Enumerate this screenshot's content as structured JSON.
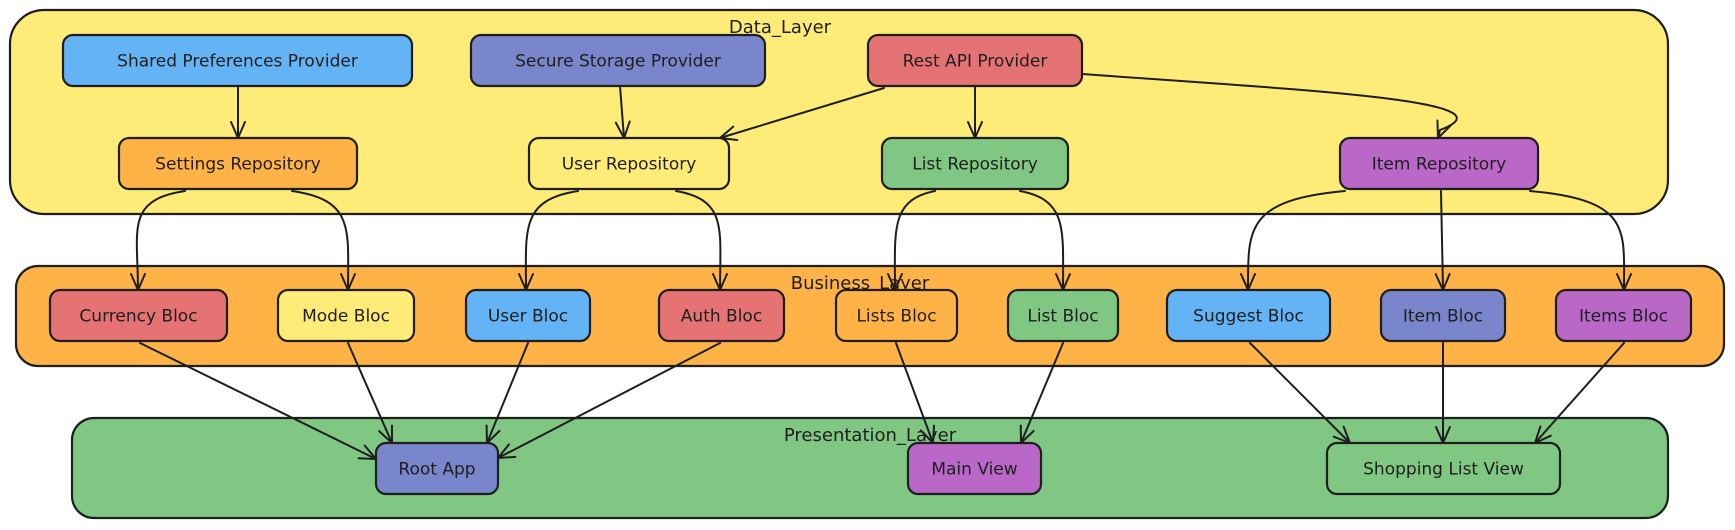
{
  "diagram": {
    "type": "layered-architecture",
    "layers": [
      {
        "id": "data",
        "label": "Data_Layer",
        "color": "#ffec78"
      },
      {
        "id": "business",
        "label": "Business_Layer",
        "color": "#ffb347"
      },
      {
        "id": "presentation",
        "label": "Presentation_Layer",
        "color": "#80c783"
      }
    ],
    "nodes": [
      {
        "id": "shared_prefs",
        "label": "Shared Preferences Provider",
        "layer": "data",
        "color": "#63b3f5"
      },
      {
        "id": "secure_storage",
        "label": "Secure Storage Provider",
        "layer": "data",
        "color": "#7986cb"
      },
      {
        "id": "rest_api",
        "label": "Rest API Provider",
        "layer": "data",
        "color": "#e57373"
      },
      {
        "id": "settings_repo",
        "label": "Settings Repository",
        "layer": "data",
        "color": "#ffb347"
      },
      {
        "id": "user_repo",
        "label": "User Repository",
        "layer": "data",
        "color": "#ffec78"
      },
      {
        "id": "list_repo",
        "label": "List Repository",
        "layer": "data",
        "color": "#80c783"
      },
      {
        "id": "item_repo",
        "label": "Item Repository",
        "layer": "data",
        "color": "#ba68c8"
      },
      {
        "id": "currency_bloc",
        "label": "Currency Bloc",
        "layer": "business",
        "color": "#e57373"
      },
      {
        "id": "mode_bloc",
        "label": "Mode Bloc",
        "layer": "business",
        "color": "#ffec78"
      },
      {
        "id": "user_bloc",
        "label": "User Bloc",
        "layer": "business",
        "color": "#63b3f5"
      },
      {
        "id": "auth_bloc",
        "label": "Auth Bloc",
        "layer": "business",
        "color": "#e57373"
      },
      {
        "id": "lists_bloc",
        "label": "Lists Bloc",
        "layer": "business",
        "color": "#ffb347"
      },
      {
        "id": "list_bloc",
        "label": "List Bloc",
        "layer": "business",
        "color": "#80c783"
      },
      {
        "id": "suggest_bloc",
        "label": "Suggest Bloc",
        "layer": "business",
        "color": "#63b3f5"
      },
      {
        "id": "item_bloc",
        "label": "Item Bloc",
        "layer": "business",
        "color": "#7986cb"
      },
      {
        "id": "items_bloc",
        "label": "Items Bloc",
        "layer": "business",
        "color": "#ba68c8"
      },
      {
        "id": "root_app",
        "label": "Root App",
        "layer": "presentation",
        "color": "#7986cb"
      },
      {
        "id": "main_view",
        "label": "Main View",
        "layer": "presentation",
        "color": "#ba68c8"
      },
      {
        "id": "shopping_list_view",
        "label": "Shopping List View",
        "layer": "presentation",
        "color": "#80c783"
      }
    ],
    "edges": [
      {
        "from": "shared_prefs",
        "to": "settings_repo"
      },
      {
        "from": "secure_storage",
        "to": "user_repo"
      },
      {
        "from": "rest_api",
        "to": "user_repo"
      },
      {
        "from": "rest_api",
        "to": "list_repo"
      },
      {
        "from": "rest_api",
        "to": "item_repo"
      },
      {
        "from": "settings_repo",
        "to": "currency_bloc"
      },
      {
        "from": "settings_repo",
        "to": "mode_bloc"
      },
      {
        "from": "user_repo",
        "to": "user_bloc"
      },
      {
        "from": "user_repo",
        "to": "auth_bloc"
      },
      {
        "from": "list_repo",
        "to": "lists_bloc"
      },
      {
        "from": "list_repo",
        "to": "list_bloc"
      },
      {
        "from": "item_repo",
        "to": "suggest_bloc"
      },
      {
        "from": "item_repo",
        "to": "item_bloc"
      },
      {
        "from": "item_repo",
        "to": "items_bloc"
      },
      {
        "from": "currency_bloc",
        "to": "root_app"
      },
      {
        "from": "mode_bloc",
        "to": "root_app"
      },
      {
        "from": "user_bloc",
        "to": "root_app"
      },
      {
        "from": "auth_bloc",
        "to": "root_app"
      },
      {
        "from": "lists_bloc",
        "to": "main_view"
      },
      {
        "from": "list_bloc",
        "to": "main_view"
      },
      {
        "from": "suggest_bloc",
        "to": "shopping_list_view"
      },
      {
        "from": "item_bloc",
        "to": "shopping_list_view"
      },
      {
        "from": "items_bloc",
        "to": "shopping_list_view"
      }
    ]
  }
}
